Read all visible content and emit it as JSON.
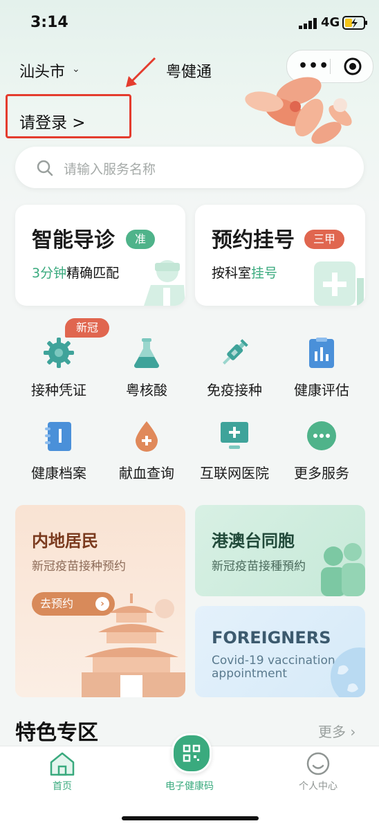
{
  "status": {
    "time": "3:14",
    "network": "4G"
  },
  "header": {
    "city": "汕头市",
    "title": "粤健通"
  },
  "login": {
    "text": "请登录 >"
  },
  "search": {
    "placeholder": "请输入服务名称"
  },
  "cards": [
    {
      "title": "智能导诊",
      "badge": "准",
      "sub_green": "3分钟",
      "sub_dark": "精确匹配"
    },
    {
      "title": "预约挂号",
      "badge": "三甲",
      "sub_dark": "按科室",
      "sub_green": "挂号"
    }
  ],
  "grid": {
    "new_badge": "新冠",
    "items": [
      {
        "label": "接种凭证",
        "icon": "gear-virus-icon"
      },
      {
        "label": "粤核酸",
        "icon": "flask-icon"
      },
      {
        "label": "免疫接种",
        "icon": "syringe-icon"
      },
      {
        "label": "健康评估",
        "icon": "chart-clipboard-icon"
      },
      {
        "label": "健康档案",
        "icon": "notebook-icon"
      },
      {
        "label": "献血查询",
        "icon": "blood-drop-icon"
      },
      {
        "label": "互联网医院",
        "icon": "monitor-plus-icon"
      },
      {
        "label": "更多服务",
        "icon": "more-dots-icon"
      }
    ]
  },
  "promos": {
    "mainland": {
      "title": "内地居民",
      "sub": "新冠疫苗接种预约",
      "button": "去预约"
    },
    "hkmt": {
      "title": "港澳台同胞",
      "sub": "新冠疫苗接種預約"
    },
    "foreigners": {
      "title": "FOREIGNERS",
      "sub1": "Covid-19 vaccination",
      "sub2": "appointment"
    }
  },
  "featured": {
    "title": "特色专区",
    "more": "更多"
  },
  "tabs": [
    {
      "label": "首页",
      "active": true
    },
    {
      "label": "电子健康码",
      "active": false
    },
    {
      "label": "个人中心",
      "active": false
    }
  ],
  "colors": {
    "accent": "#3aaa7e",
    "highlight_red": "#e43c2e",
    "orange": "#e0664f"
  }
}
